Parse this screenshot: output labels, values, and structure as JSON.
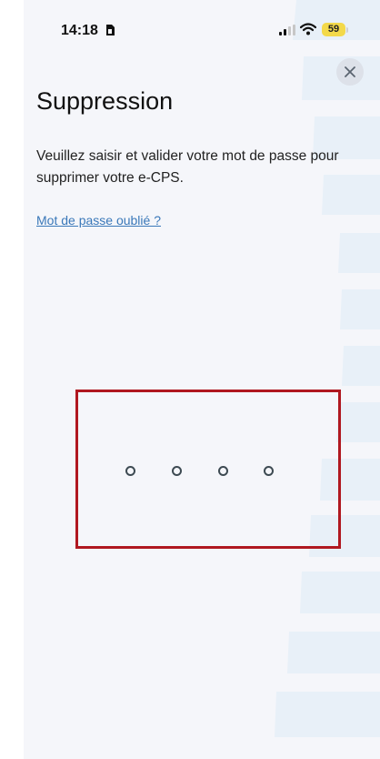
{
  "status_bar": {
    "time": "14:18",
    "battery": "59",
    "icons": [
      "sim-card-icon",
      "cellular-signal-icon",
      "wifi-icon",
      "battery-icon"
    ]
  },
  "header": {
    "close_icon": "close-icon"
  },
  "main": {
    "title": "Suppression",
    "instruction": "Veuillez saisir et valider votre mot de passe pour supprimer votre e-CPS.",
    "forgot_password_link": "Mot de passe oublié ?"
  },
  "pin_entry": {
    "digits_total": 4,
    "digits_entered": 0
  },
  "colors": {
    "background": "#f5f6fa",
    "accent_link": "#3a78b9",
    "highlight_frame": "#b01820",
    "battery": "#f3d94a"
  }
}
